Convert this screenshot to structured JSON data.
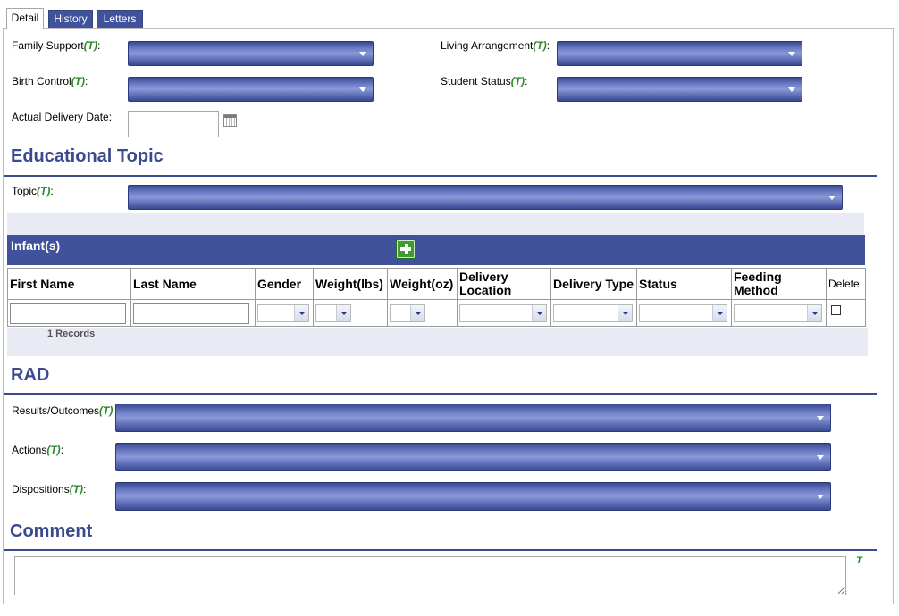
{
  "tabs": [
    {
      "label": "Detail",
      "active": true
    },
    {
      "label": "History",
      "active": false
    },
    {
      "label": "Letters",
      "active": false
    }
  ],
  "t_marker": "(T)",
  "fields": {
    "family_support": {
      "label": "Family Support",
      "colon": ":"
    },
    "living_arrangement": {
      "label": "Living Arrangement",
      "colon": ":"
    },
    "birth_control": {
      "label": "Birth Control",
      "colon": ":"
    },
    "student_status": {
      "label": "Student Status",
      "colon": ":"
    },
    "actual_delivery_date": {
      "label": "Actual Delivery Date:",
      "value": ""
    }
  },
  "educational_topic": {
    "title": "Educational Topic",
    "topic_label": "Topic",
    "colon": ":"
  },
  "infants": {
    "title": "Infant(s)",
    "columns": [
      "First Name",
      "Last Name",
      "Gender",
      "Weight(lbs)",
      "Weight(oz)",
      "Delivery Location",
      "Delivery Type",
      "Status",
      "Feeding Method",
      "Delete"
    ],
    "row": {
      "first_name": "",
      "last_name": ""
    },
    "records_text": "1 Records"
  },
  "rad": {
    "title": "RAD",
    "results_label": "Results/Outcomes",
    "actions_label": "Actions",
    "dispositions_label": "Dispositions",
    "colon": ":"
  },
  "comment": {
    "title": "Comment",
    "t_mark": "T",
    "value": ""
  },
  "colors": {
    "accent": "#3b4a8e",
    "tab_blue": "#41529c",
    "t_marker_green": "#2a8a2a"
  }
}
